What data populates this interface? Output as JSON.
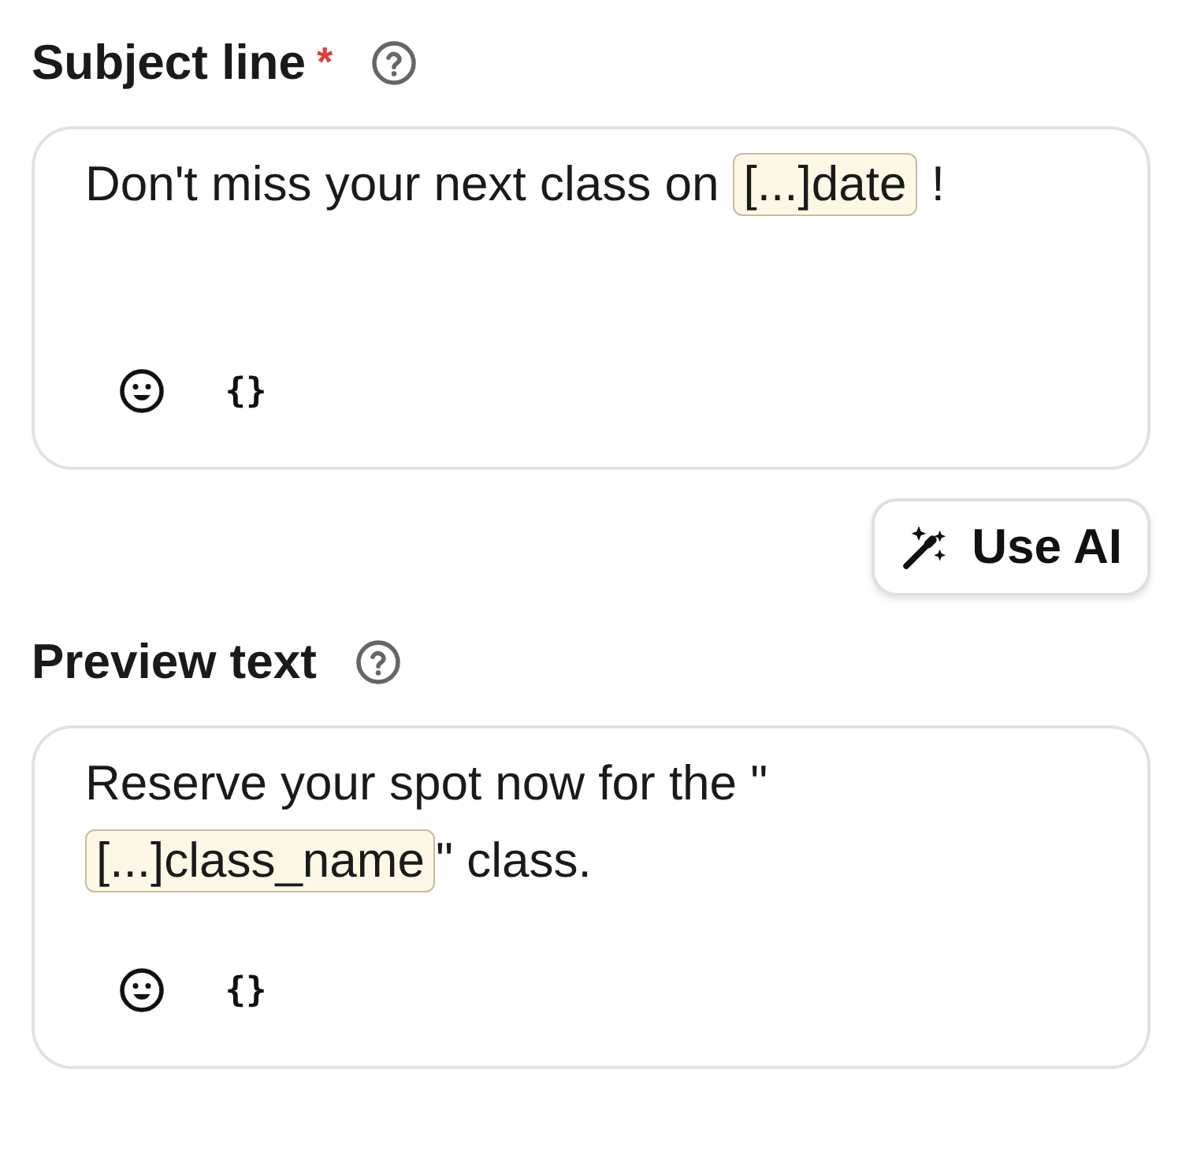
{
  "fields": [
    {
      "label": "Subject line",
      "required_mark": "*",
      "segments": [
        {
          "kind": "text",
          "text": "Don't miss your next class on "
        },
        {
          "kind": "tag",
          "text": "[...]date"
        },
        {
          "kind": "text",
          "text": " !"
        }
      ],
      "variable_button": "{}"
    },
    {
      "label": "Preview text",
      "segments": [
        {
          "kind": "text",
          "text": "Reserve your spot now for the \""
        },
        {
          "kind": "tag",
          "text": "[...]class_name"
        },
        {
          "kind": "text",
          "text": "\" class."
        }
      ],
      "variable_button": "{}"
    }
  ],
  "ai_button": {
    "label": "Use AI"
  }
}
